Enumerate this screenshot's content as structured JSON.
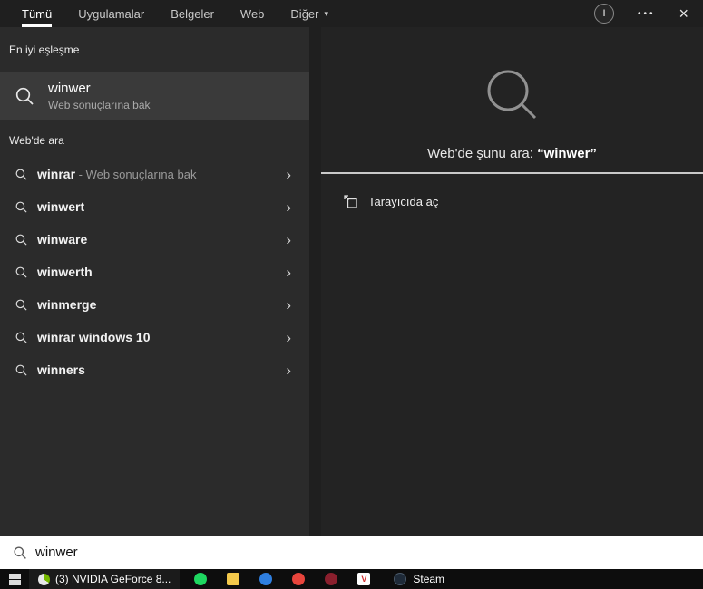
{
  "topbar": {
    "tabs": [
      "Tümü",
      "Uygulamalar",
      "Belgeler",
      "Web",
      "Diğer"
    ],
    "more_caret": "▾",
    "avatar_letter": "I",
    "more_options_glyph": "•••",
    "close_glyph": "×"
  },
  "left_panel": {
    "best_match_header": "En iyi eşleşme",
    "best_match": {
      "title": "winwer",
      "subtitle": "Web sonuçlarına bak"
    },
    "web_search_header": "Web'de ara",
    "chevron": "›",
    "suggestions": [
      {
        "label": "winrar",
        "suffix": " - Web sonuçlarına bak"
      },
      {
        "label": "winwert"
      },
      {
        "label": "winware"
      },
      {
        "label": "winwerth"
      },
      {
        "label": "winmerge"
      },
      {
        "label": "winrar windows 10"
      },
      {
        "label": "winners"
      }
    ]
  },
  "right_panel": {
    "prompt_prefix": "Web'de şunu ara: ",
    "prompt_query": "“winwer”",
    "open_browser_label": "Tarayıcıda aç"
  },
  "search_bar": {
    "value": "winwer"
  },
  "taskbar": {
    "nvidia_task_label": "(3) NVIDIA GeForce 8...",
    "steam_task_label": "Steam",
    "app_icons": [
      {
        "name": "spotify-icon",
        "color": "#1ed760",
        "radius": "50%"
      },
      {
        "name": "file-explorer-icon",
        "color": "#f3c84b",
        "radius": "2px"
      },
      {
        "name": "blue-app-icon",
        "color": "#2f7fe0",
        "radius": "50%"
      },
      {
        "name": "red-app-icon",
        "color": "#e8453c",
        "radius": "50%"
      },
      {
        "name": "maroon-app-icon",
        "color": "#8a1f2d",
        "radius": "50%"
      },
      {
        "name": "v-app-icon",
        "color": "#ffffff",
        "radius": "2px",
        "glyph": "V",
        "glyph_color": "#d32f2f"
      }
    ]
  },
  "colors": {
    "topbar_bg": "#1f1f1f",
    "left_panel_bg": "#2b2b2b",
    "best_match_bg": "#3a3a3a",
    "right_panel_bg": "#232323",
    "active_tab_underline": "#ffffff",
    "searchbar_bg": "#ffffff",
    "taskbar_bg": "#0d0d0d"
  }
}
